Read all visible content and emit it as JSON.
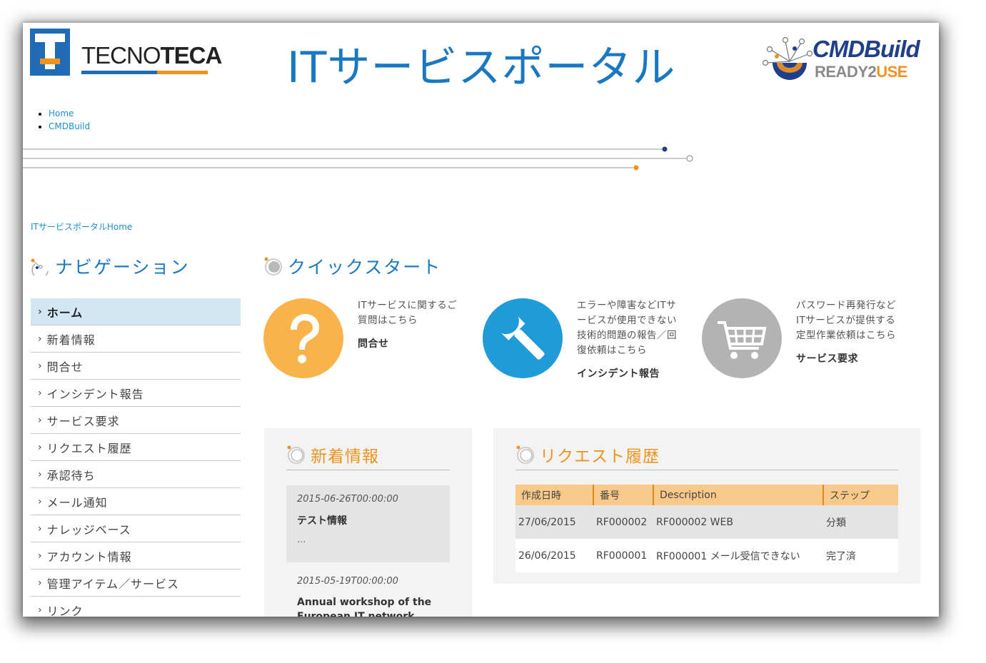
{
  "header": {
    "tecnoteca_logo": "TECNOTECA",
    "site_title": "ITサービスポータル",
    "cmdbuild_logo": {
      "line1": "CMDBuild",
      "line2": "READY2USE"
    }
  },
  "top_links": [
    "Home",
    "CMDBuild"
  ],
  "page_breadcrumb": "ITサービスポータルHome",
  "navigation": {
    "title": "ナビゲーション",
    "items": [
      "ホーム",
      "新着情報",
      "問合せ",
      "インシデント報告",
      "サービス要求",
      "リクエスト履歴",
      "承認待ち",
      "メール通知",
      "ナレッジベース",
      "アカウント情報",
      "管理アイテム／サービス",
      "リンク"
    ],
    "active_index": 0
  },
  "quick_start": {
    "title": "クイックスタート",
    "cards": [
      {
        "icon": "question-icon",
        "color": "#fab24a",
        "lines": [
          "ITサービスに関するご",
          "質問はこちら"
        ],
        "link": "問合せ"
      },
      {
        "icon": "wrench-icon",
        "color": "#1f9bd8",
        "lines": [
          "エラーや障害などITサ",
          "ービスが使用できない",
          "技術的問題の報告／回",
          "復依頼はこちら"
        ],
        "link": "インシデント報告"
      },
      {
        "icon": "cart-icon",
        "color": "#b3b3b3",
        "lines": [
          "パスワード再発行など",
          "ITサービスが提供する",
          "定型作業依頼はこちら"
        ],
        "link": "サービス要求"
      }
    ]
  },
  "news": {
    "title": "新着情報",
    "items": [
      {
        "date": "2015-06-26T00:00:00",
        "title": "テスト情報",
        "excerpt": "..."
      },
      {
        "date": "2015-05-19T00:00:00",
        "title": "Annual workshop of the European IT network"
      }
    ]
  },
  "request_history": {
    "title": "リクエスト履歴",
    "columns": [
      "作成日時",
      "番号",
      "Description",
      "ステップ"
    ],
    "rows": [
      [
        "27/06/2015",
        "RF000002",
        "RF000002 WEB",
        "分類"
      ],
      [
        "26/06/2015",
        "RF000001",
        "RF000001 メール受信できない",
        "完了済"
      ]
    ]
  },
  "colors": {
    "accent_blue": "#1a78c2",
    "accent_orange": "#f0931e",
    "nav_active": "#d2e6f3"
  }
}
